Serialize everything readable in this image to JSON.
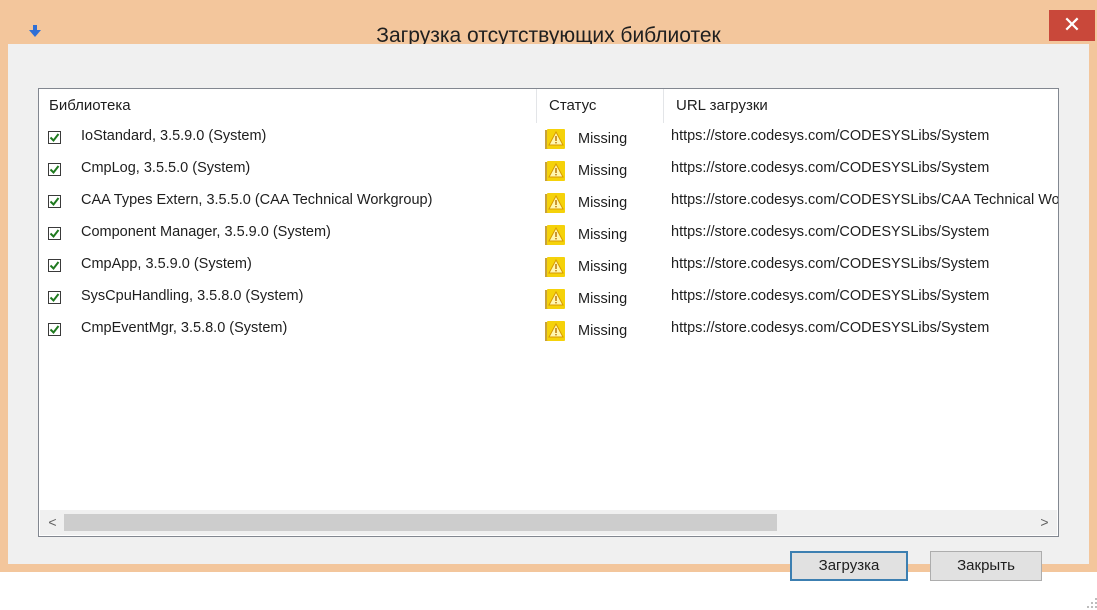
{
  "window": {
    "title": "Загрузка отсутствующих библиотек",
    "close_glyph": "✕"
  },
  "list": {
    "columns": {
      "library": "Библиотека",
      "status": "Статус",
      "url": "URL загрузки"
    },
    "rows": [
      {
        "checked": true,
        "library": "IoStandard, 3.5.9.0 (System)",
        "status": "Missing",
        "url": "https://store.codesys.com/CODESYSLibs/System"
      },
      {
        "checked": true,
        "library": "CmpLog, 3.5.5.0 (System)",
        "status": "Missing",
        "url": "https://store.codesys.com/CODESYSLibs/System"
      },
      {
        "checked": true,
        "library": "CAA Types Extern, 3.5.5.0 (CAA Technical Workgroup)",
        "status": "Missing",
        "url": "https://store.codesys.com/CODESYSLibs/CAA Technical Workgroup"
      },
      {
        "checked": true,
        "library": "Component Manager, 3.5.9.0 (System)",
        "status": "Missing",
        "url": "https://store.codesys.com/CODESYSLibs/System"
      },
      {
        "checked": true,
        "library": "CmpApp, 3.5.9.0 (System)",
        "status": "Missing",
        "url": "https://store.codesys.com/CODESYSLibs/System"
      },
      {
        "checked": true,
        "library": "SysCpuHandling, 3.5.8.0 (System)",
        "status": "Missing",
        "url": "https://store.codesys.com/CODESYSLibs/System"
      },
      {
        "checked": true,
        "library": "CmpEventMgr, 3.5.8.0 (System)",
        "status": "Missing",
        "url": "https://store.codesys.com/CODESYSLibs/System"
      }
    ],
    "scroll": {
      "left_glyph": "<",
      "right_glyph": ">"
    }
  },
  "buttons": {
    "download": "Загрузка",
    "close": "Закрыть"
  },
  "icons": {
    "title": "arrow-down-icon",
    "status": "warning-icon"
  },
  "colors": {
    "frame": "#f3c69c",
    "close": "#c9483a",
    "check": "#1f7a1f",
    "warning": "#f5d20a"
  }
}
